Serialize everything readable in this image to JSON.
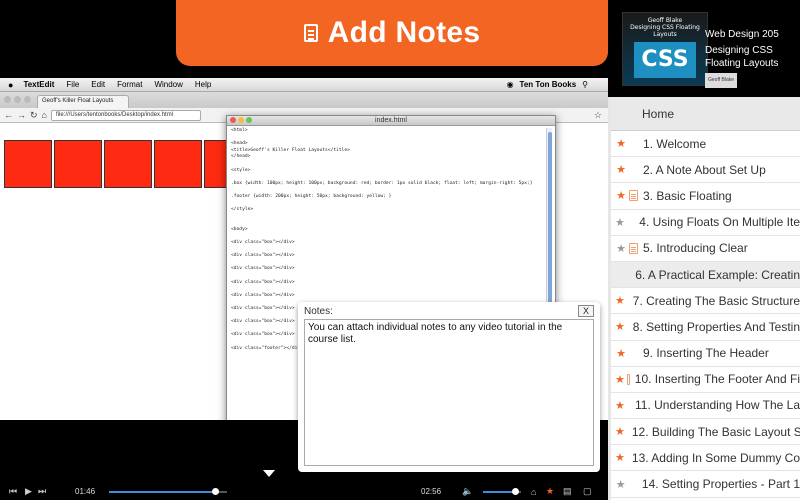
{
  "banner": {
    "title": "Add Notes",
    "icon": "document-icon"
  },
  "course": {
    "cover_series": "Web Design 205",
    "cover_title": "Designing CSS Floating Layouts",
    "cover_big": "CSS",
    "cover_top": "Geoff Blake",
    "series": "Web Design 205",
    "title": "Designing CSS Floating Layouts",
    "author": "Geoff Blake"
  },
  "mac": {
    "apple": "",
    "app_name": "TextEdit",
    "menus": [
      "File",
      "Edit",
      "Format",
      "Window",
      "Help"
    ],
    "brand": "Ten Ton Books"
  },
  "browser": {
    "tab_title": "Geoff's Killer Float Layouts",
    "url": "file:///Users/tentonbooks/Desktop/index.html"
  },
  "editor": {
    "title": "index.html",
    "code": "<html>\n\n<head>\n<title>Geoff's Killer Float Layouts</title>\n</head>\n\n<style>\n\n.box {width: 100px; height: 100px; background: red; border: 1px solid black; float: left; margin-right: 5px;}\n\n.footer {width: 200px; height: 50px; background: yellow; }\n\n</style>\n\n\n<body>\n\n<div class=\"box\"></div>\n\n<div class=\"box\"></div>\n\n<div class=\"box\"></div>\n\n<div class=\"box\"></div>\n\n<div class=\"box\"></div>\n\n<div class=\"box\"></div>\n\n<div class=\"box\"></div>\n\n<div class=\"box\"></div>\n\n<div class=\"footer\"></div>"
  },
  "notes": {
    "label": "Notes:",
    "close": "X",
    "text": "You can attach individual notes to any video tutorial in the course list."
  },
  "player": {
    "elapsed": "01:46",
    "remaining": "02:56",
    "progress": 0.9,
    "volume": 0.85
  },
  "sidebar": {
    "home": "Home",
    "items": [
      {
        "label": "1. Welcome",
        "star": "orange",
        "note": false
      },
      {
        "label": "2. A Note About Set Up",
        "star": "orange",
        "note": false
      },
      {
        "label": "3. Basic Floating",
        "star": "orange",
        "note": true
      },
      {
        "label": "4. Using Floats On Multiple Ite",
        "star": "gray",
        "note": false
      },
      {
        "label": "5. Introducing Clear",
        "star": "gray",
        "note": true
      },
      {
        "label": "6. A Practical Example: Creatin",
        "star": "none",
        "note": false,
        "active": true
      },
      {
        "label": "7. Creating The Basic Structure",
        "star": "orange",
        "note": false
      },
      {
        "label": "8. Setting Properties And Testin",
        "star": "orange",
        "note": false
      },
      {
        "label": "9. Inserting The Header",
        "star": "orange",
        "note": false
      },
      {
        "label": "10. Inserting The Footer And Fi",
        "star": "orange",
        "note": true
      },
      {
        "label": "11. Understanding How The La",
        "star": "orange",
        "note": false
      },
      {
        "label": "12. Building The Basic Layout S",
        "star": "orange",
        "note": false
      },
      {
        "label": "13. Adding In Some Dummy Co",
        "star": "orange",
        "note": false
      },
      {
        "label": "14. Setting Properties - Part 1",
        "star": "gray",
        "note": false
      }
    ]
  },
  "colors": {
    "accent": "#f26522",
    "box_red": "#ff2a12",
    "progress": "#3b8edb"
  }
}
